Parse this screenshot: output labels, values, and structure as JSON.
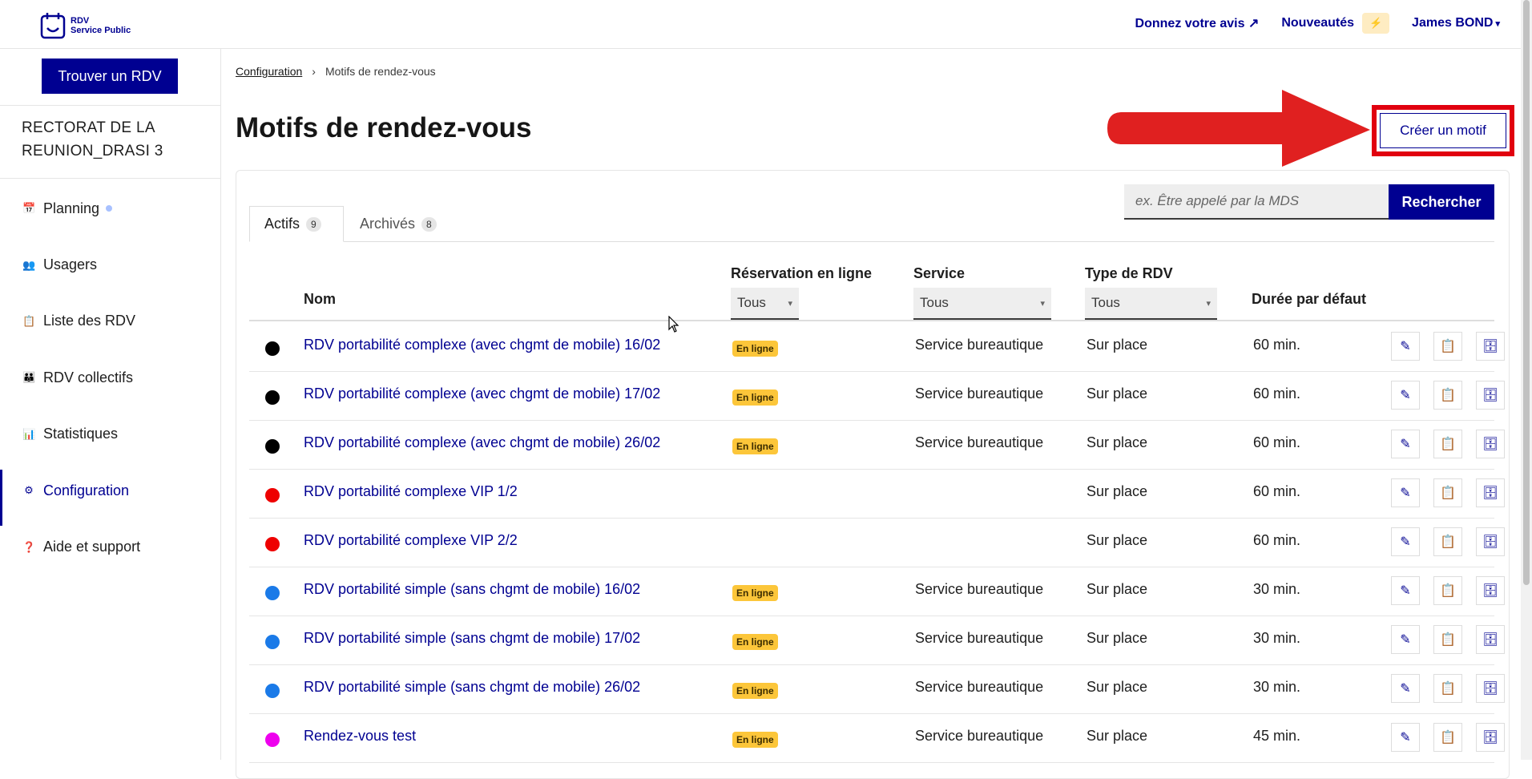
{
  "header": {
    "logo_line1": "RDV",
    "logo_line2": "Service Public",
    "feedback": "Donnez votre avis",
    "news": "Nouveautés",
    "user": "James BOND"
  },
  "sidebar": {
    "find_button": "Trouver un RDV",
    "org_name": "RECTORAT DE LA REUNION_DRASI 3",
    "items": [
      {
        "label": "Planning",
        "icon": "calendar-icon"
      },
      {
        "label": "Usagers",
        "icon": "users-icon"
      },
      {
        "label": "Liste des RDV",
        "icon": "clipboard-icon"
      },
      {
        "label": "RDV collectifs",
        "icon": "group-icon"
      },
      {
        "label": "Statistiques",
        "icon": "chart-icon"
      },
      {
        "label": "Configuration",
        "icon": "gear-icon"
      },
      {
        "label": "Aide et support",
        "icon": "help-icon"
      }
    ]
  },
  "breadcrumb": {
    "root": "Configuration",
    "current": "Motifs de rendez-vous"
  },
  "page": {
    "title": "Motifs de rendez-vous",
    "create_button": "Créer un motif"
  },
  "search": {
    "placeholder": "ex. Être appelé par la MDS",
    "button": "Rechercher"
  },
  "tabs": {
    "active_label": "Actifs",
    "active_count": "9",
    "archived_label": "Archivés",
    "archived_count": "8"
  },
  "table": {
    "headers": {
      "nom": "Nom",
      "reservation": "Réservation en ligne",
      "service": "Service",
      "type": "Type de RDV",
      "duree": "Durée par défaut"
    },
    "filters": {
      "reservation": "Tous",
      "service": "Tous",
      "type": "Tous"
    },
    "online_badge": "En ligne",
    "rows": [
      {
        "color": "#000000",
        "name": "RDV portabilité complexe (avec chgmt de mobile) 16/02",
        "online": true,
        "service": "Service bureautique",
        "type": "Sur place",
        "duration": "60 min."
      },
      {
        "color": "#000000",
        "name": "RDV portabilité complexe (avec chgmt de mobile) 17/02",
        "online": true,
        "service": "Service bureautique",
        "type": "Sur place",
        "duration": "60 min."
      },
      {
        "color": "#000000",
        "name": "RDV portabilité complexe (avec chgmt de mobile) 26/02",
        "online": true,
        "service": "Service bureautique",
        "type": "Sur place",
        "duration": "60 min."
      },
      {
        "color": "#ee0000",
        "name": "RDV portabilité complexe VIP 1/2",
        "online": false,
        "service": "",
        "type": "Sur place",
        "duration": "60 min."
      },
      {
        "color": "#ee0000",
        "name": "RDV portabilité complexe VIP 2/2",
        "online": false,
        "service": "",
        "type": "Sur place",
        "duration": "60 min."
      },
      {
        "color": "#1a7ae8",
        "name": "RDV portabilité simple (sans chgmt de mobile) 16/02",
        "online": true,
        "service": "Service bureautique",
        "type": "Sur place",
        "duration": "30 min."
      },
      {
        "color": "#1a7ae8",
        "name": "RDV portabilité simple (sans chgmt de mobile) 17/02",
        "online": true,
        "service": "Service bureautique",
        "type": "Sur place",
        "duration": "30 min."
      },
      {
        "color": "#1a7ae8",
        "name": "RDV portabilité simple (sans chgmt de mobile) 26/02",
        "online": true,
        "service": "Service bureautique",
        "type": "Sur place",
        "duration": "30 min."
      },
      {
        "color": "#ee00ee",
        "name": "Rendez-vous test",
        "online": true,
        "service": "Service bureautique",
        "type": "Sur place",
        "duration": "45 min."
      }
    ]
  }
}
